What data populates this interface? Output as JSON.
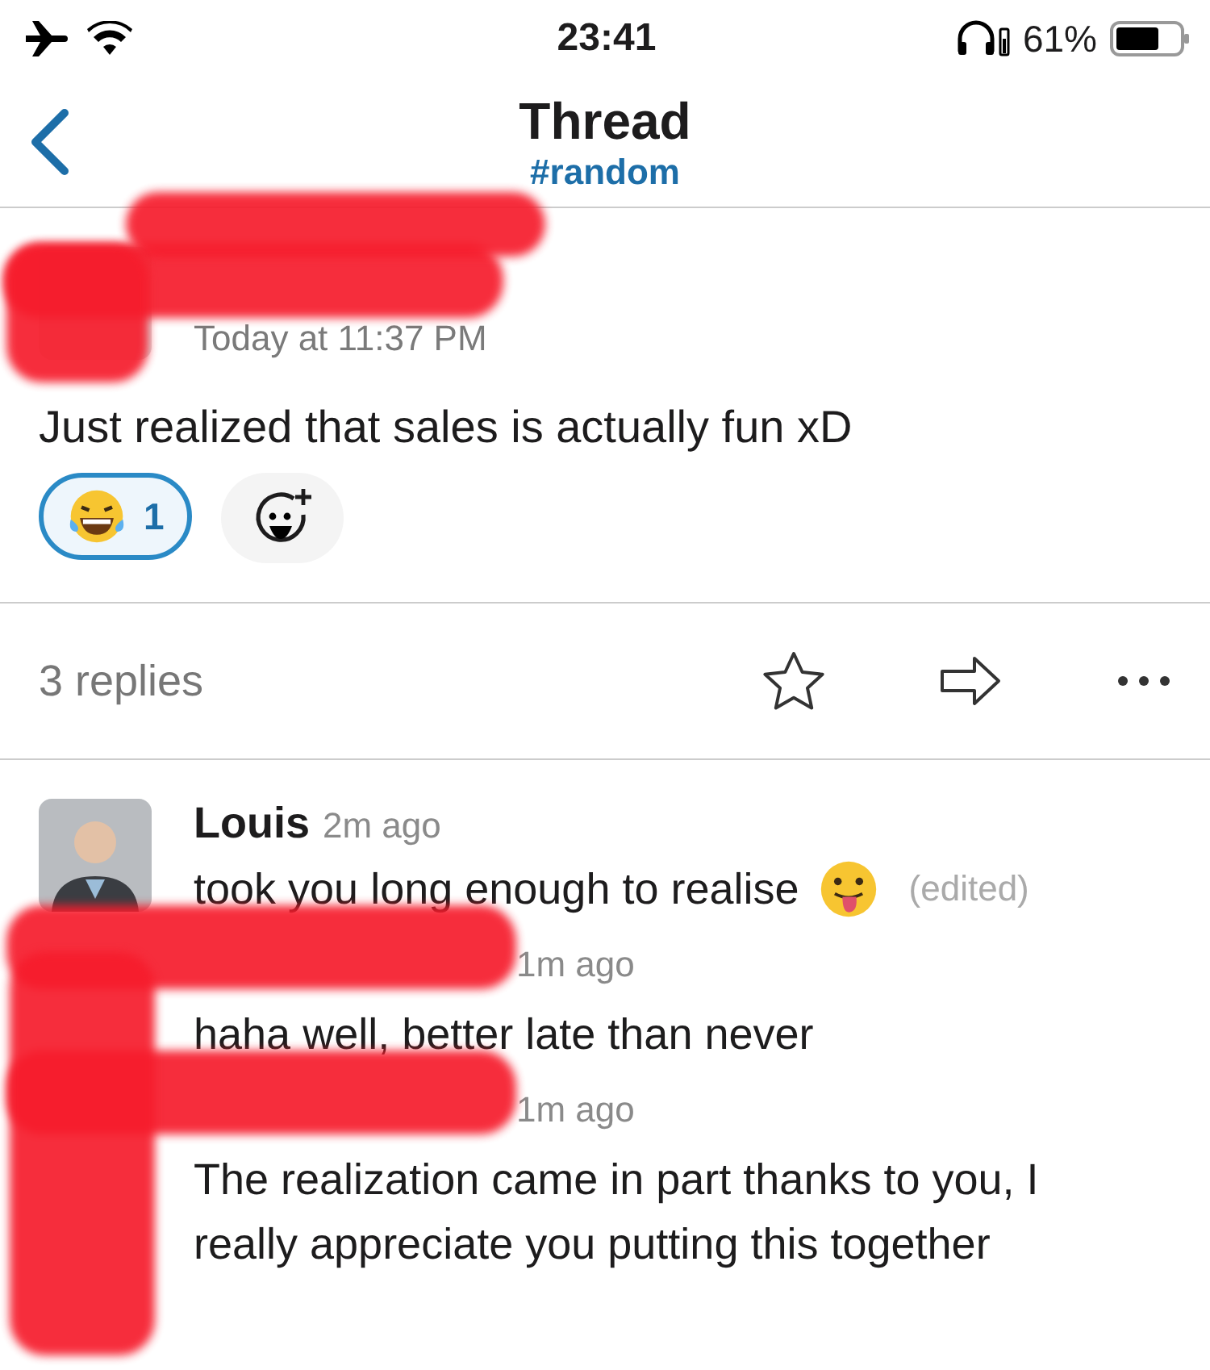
{
  "status_bar": {
    "time": "23:41",
    "battery": "61%"
  },
  "header": {
    "title": "Thread",
    "channel": "#random"
  },
  "parent": {
    "author_redacted": true,
    "timestamp": "Today at 11:37 PM",
    "text": "Just realized that sales is actually fun xD",
    "reactions": [
      {
        "count": "1",
        "selected": true
      }
    ]
  },
  "replies_bar": {
    "label": "3 replies"
  },
  "replies": [
    {
      "author": "Louis",
      "time": "2m ago",
      "text": "took you long enough to realise",
      "has_emoji": true,
      "edited": "(edited)"
    },
    {
      "author_redacted": true,
      "time": "1m ago",
      "text": "haha well, better late than never",
      "has_emoji": false
    },
    {
      "author_redacted": true,
      "time": "1m ago",
      "text": "The realization came in part thanks to you, I really appreciate you putting this together",
      "has_emoji": false
    }
  ]
}
